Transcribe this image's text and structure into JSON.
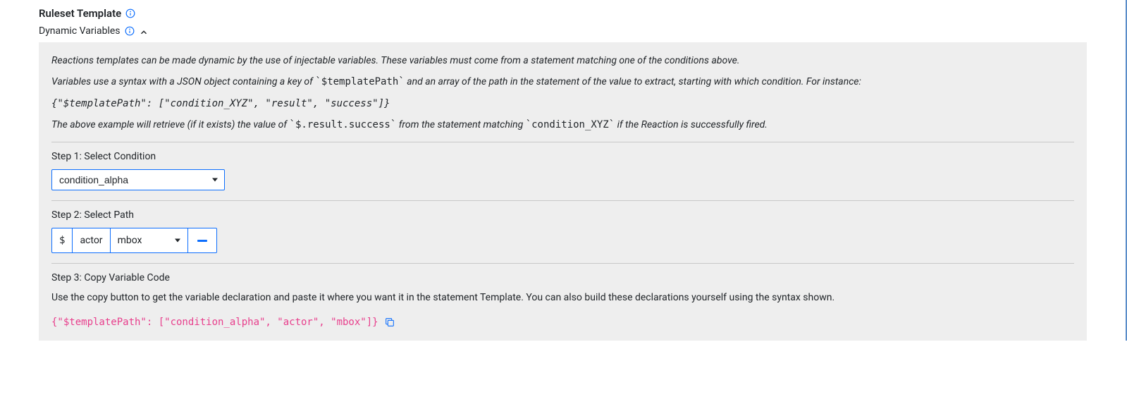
{
  "header": {
    "title": "Ruleset Template",
    "subtitle": "Dynamic Variables"
  },
  "intro": {
    "p1": "Reactions templates can be made dynamic by the use of injectable variables. These variables must come from a statement matching one of the conditions above.",
    "p2_pre": "Variables use a syntax with a JSON object containing a key of ",
    "p2_code1": "`$templatePath`",
    "p2_post": " and an array of the path in the statement of the value to extract, starting with which condition. For instance:",
    "code_example": "{\"$templatePath\": [\"condition_XYZ\", \"result\", \"success\"]}",
    "p3_pre": "The above example will retrieve (if it exists) the value of ",
    "p3_code1": "`$.result.success`",
    "p3_mid": " from the statement matching ",
    "p3_code2": "`condition_XYZ`",
    "p3_post": " if the Reaction is successfully fired."
  },
  "step1": {
    "label": "Step 1: Select Condition",
    "selected": "condition_alpha"
  },
  "step2": {
    "label": "Step 2: Select Path",
    "root": "$",
    "seg1": "actor",
    "seg2": "mbox"
  },
  "step3": {
    "label": "Step 3: Copy Variable Code",
    "text": "Use the copy button to get the variable declaration and paste it where you want it in the statement Template. You can also build these declarations yourself using the syntax shown.",
    "result_code": "{\"$templatePath\": [\"condition_alpha\", \"actor\", \"mbox\"]}"
  }
}
